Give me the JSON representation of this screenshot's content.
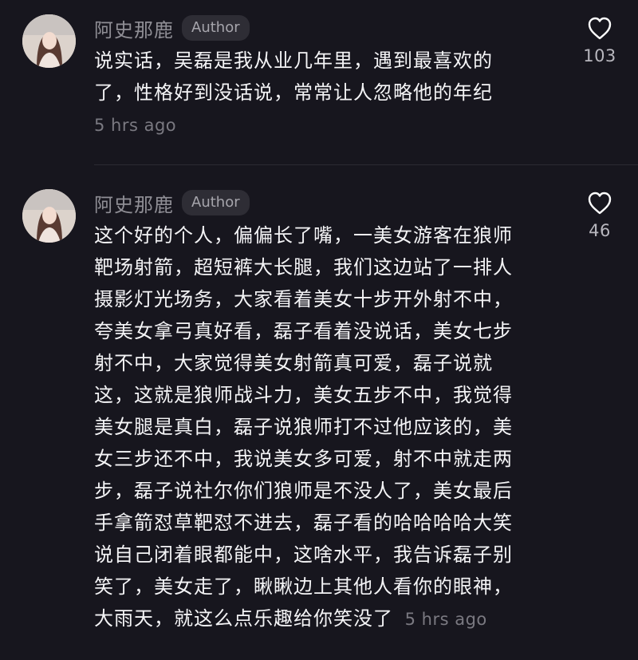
{
  "comments": [
    {
      "author": "阿史那鹿",
      "badge": "Author",
      "lines": [
        "说实话，吴磊是我从业几年里，遇到最喜欢的",
        "了，性格好到没话说，常常让人忽略他的年纪"
      ],
      "time": "5 hrs ago",
      "likes": "103"
    },
    {
      "author": "阿史那鹿",
      "badge": "Author",
      "lines": [
        "这个好的个人，偏偏长了嘴，一美女游客在狼师",
        "靶场射箭，超短裤大长腿，我们这边站了一排人",
        "摄影灯光场务，大家看着美女十步开外射不中，",
        "夸美女拿弓真好看，磊子看着没说话，美女七步",
        "射不中，大家觉得美女射箭真可爱，磊子说就",
        "这，这就是狼师战斗力，美女五步不中，我觉得",
        "美女腿是真白，磊子说狼师打不过他应该的，美",
        "女三步还不中，我说美女多可爱，射不中就走两",
        "步，磊子说社尔你们狼师是不没人了，美女最后",
        "手拿箭怼草靶怼不进去，磊子看的哈哈哈哈大笑",
        "说自己闭着眼都能中，这啥水平，我告诉磊子别",
        "笑了，美女走了，瞅瞅边上其他人看你的眼神，",
        "大雨天，就这么点乐趣给你笑没了"
      ],
      "time": "5 hrs ago",
      "likes": "46"
    }
  ],
  "icons": {
    "like": "heart-outline-icon",
    "avatar": "avatar-icon"
  },
  "colors": {
    "background": "#17161e",
    "text": "#f4f4f6",
    "muted": "#8f8e95",
    "badge_bg": "#2e2d35"
  }
}
